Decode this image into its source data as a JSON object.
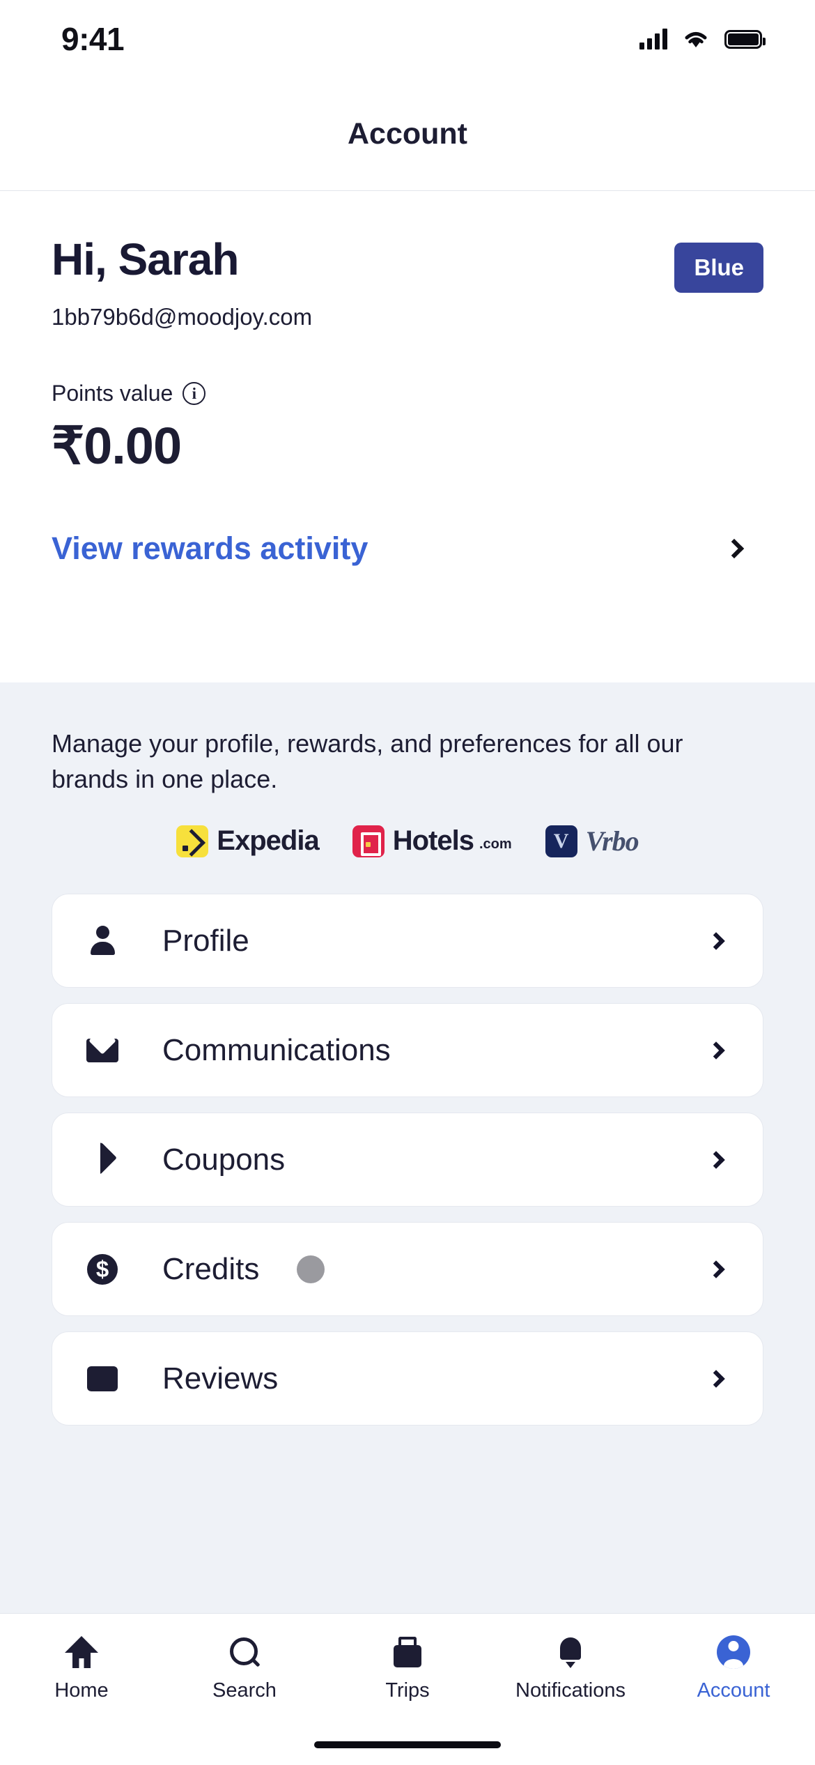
{
  "statusbar": {
    "time": "9:41",
    "signal_icon": "cellular-signal-icon",
    "wifi_icon": "wifi-icon",
    "battery_icon": "battery-icon"
  },
  "appbar": {
    "title": "Account"
  },
  "hero": {
    "greeting": "Hi, Sarah",
    "email": "1bb79b6d@moodjoy.com",
    "tier_badge": "Blue",
    "points_label": "Points value",
    "points_info_icon": "info-icon",
    "points_amount": "₹0.00",
    "rewards_link": "View rewards activity",
    "rewards_chevron_icon": "chevron-right-icon"
  },
  "section": {
    "description": "Manage your profile, rewards, and preferences for all our brands in one place.",
    "brands": [
      {
        "name": "Expedia",
        "tld": "",
        "logo_icon": "expedia-logo-icon"
      },
      {
        "name": "Hotels",
        "tld": ".com",
        "logo_icon": "hotels-logo-icon"
      },
      {
        "name": "Vrbo",
        "tld": "",
        "logo_icon": "vrbo-logo-icon"
      }
    ]
  },
  "menu": {
    "items": [
      {
        "label": "Profile",
        "icon": "person-icon",
        "chevron": "chevron-right-icon",
        "loading": false
      },
      {
        "label": "Communications",
        "icon": "mail-icon",
        "chevron": "chevron-right-icon",
        "loading": false
      },
      {
        "label": "Coupons",
        "icon": "tag-icon",
        "chevron": "chevron-right-icon",
        "loading": false
      },
      {
        "label": "Credits",
        "icon": "dollar-circle-icon",
        "chevron": "chevron-right-icon",
        "loading": true
      },
      {
        "label": "Reviews",
        "icon": "review-icon",
        "chevron": "chevron-right-icon",
        "loading": false
      }
    ]
  },
  "tabbar": {
    "tabs": [
      {
        "label": "Home",
        "icon": "home-icon",
        "active": false
      },
      {
        "label": "Search",
        "icon": "search-icon",
        "active": false
      },
      {
        "label": "Trips",
        "icon": "suitcase-icon",
        "active": false
      },
      {
        "label": "Notifications",
        "icon": "bell-icon",
        "active": false
      },
      {
        "label": "Account",
        "icon": "account-avatar-icon",
        "active": true
      }
    ]
  },
  "colors": {
    "accent_blue": "#3a63d4",
    "badge_blue": "#38459c",
    "text_dark": "#1d1d33",
    "section_bg": "#eff2f7",
    "card_bg": "#ffffff",
    "skeleton_gray": "#9a9a9f"
  }
}
